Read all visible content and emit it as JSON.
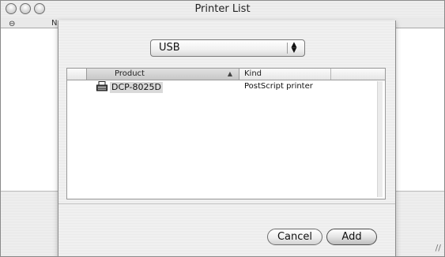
{
  "window": {
    "title": "Printer List",
    "bg_columns": {
      "icon": "⊖",
      "name_partial": "N"
    },
    "resize_glyph": "//"
  },
  "sheet": {
    "connection_popup": {
      "selected": "USB",
      "arrow": "⬍"
    },
    "table": {
      "columns": [
        {
          "label": "Product",
          "sort": "ascending"
        },
        {
          "label": "Kind"
        }
      ],
      "rows": [
        {
          "product": "DCP-8025D",
          "kind": "PostScript printer",
          "icon": "printer-icon",
          "selected": true
        }
      ]
    },
    "buttons": {
      "cancel": "Cancel",
      "add": "Add"
    }
  },
  "colors": {
    "selection": "#d9d9d9",
    "window_bg": "#ececec"
  }
}
